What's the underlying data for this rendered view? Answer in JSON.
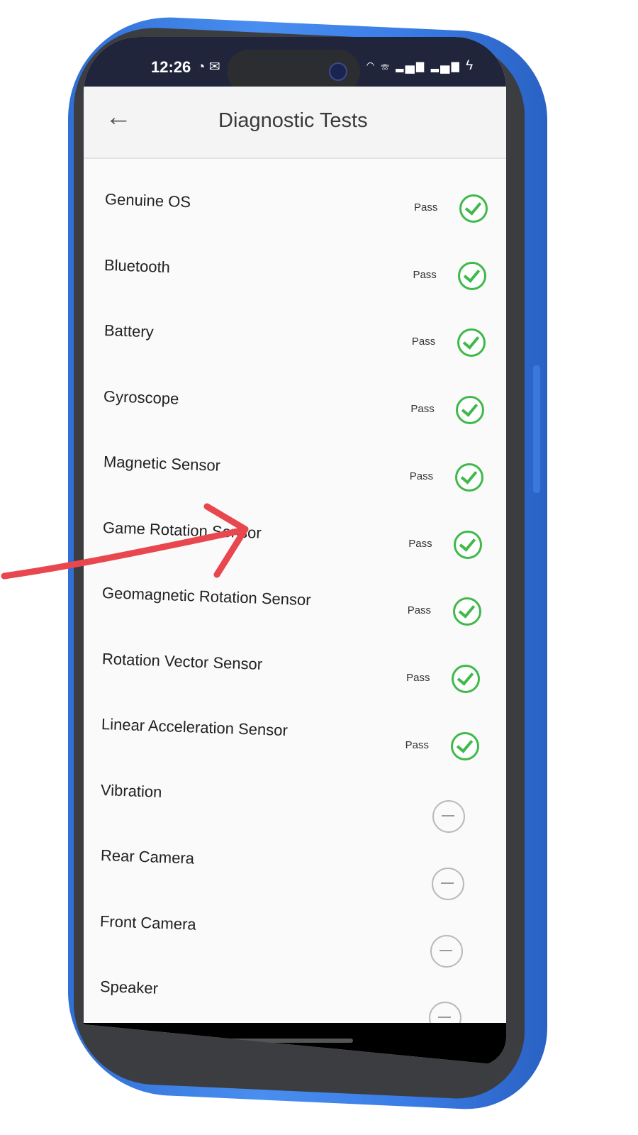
{
  "status_bar": {
    "time": "12:26",
    "left_icons": [
      "whatsapp-icon",
      "mail-icon"
    ],
    "right_icons": [
      "bluetooth-icon",
      "wifi-icon",
      "call-icon",
      "signal-icon",
      "signal-icon",
      "charging-icon"
    ]
  },
  "app_bar": {
    "title": "Diagnostic Tests",
    "back_icon": "arrow-left-icon"
  },
  "colors": {
    "frame": "#3a7de6",
    "status_bar": "#20253b",
    "pass_green": "#3fb94a",
    "pending_gray": "#b9b9b9",
    "annotation_red": "#e8474f"
  },
  "tests": [
    {
      "name": "Genuine OS",
      "status": "Pass",
      "result": "pass"
    },
    {
      "name": "Bluetooth",
      "status": "Pass",
      "result": "pass"
    },
    {
      "name": "Battery",
      "status": "Pass",
      "result": "pass"
    },
    {
      "name": "Gyroscope",
      "status": "Pass",
      "result": "pass"
    },
    {
      "name": "Magnetic Sensor",
      "status": "Pass",
      "result": "pass"
    },
    {
      "name": "Game Rotation Sensor",
      "status": "Pass",
      "result": "pass"
    },
    {
      "name": "Geomagnetic Rotation Sensor",
      "status": "Pass",
      "result": "pass"
    },
    {
      "name": "Rotation Vector Sensor",
      "status": "Pass",
      "result": "pass"
    },
    {
      "name": "Linear Acceleration Sensor",
      "status": "Pass",
      "result": "pass"
    },
    {
      "name": "Vibration",
      "status": "",
      "result": "pending"
    },
    {
      "name": "Rear Camera",
      "status": "",
      "result": "pending"
    },
    {
      "name": "Front Camera",
      "status": "",
      "result": "pending"
    },
    {
      "name": "Speaker",
      "status": "",
      "result": "pending"
    }
  ]
}
